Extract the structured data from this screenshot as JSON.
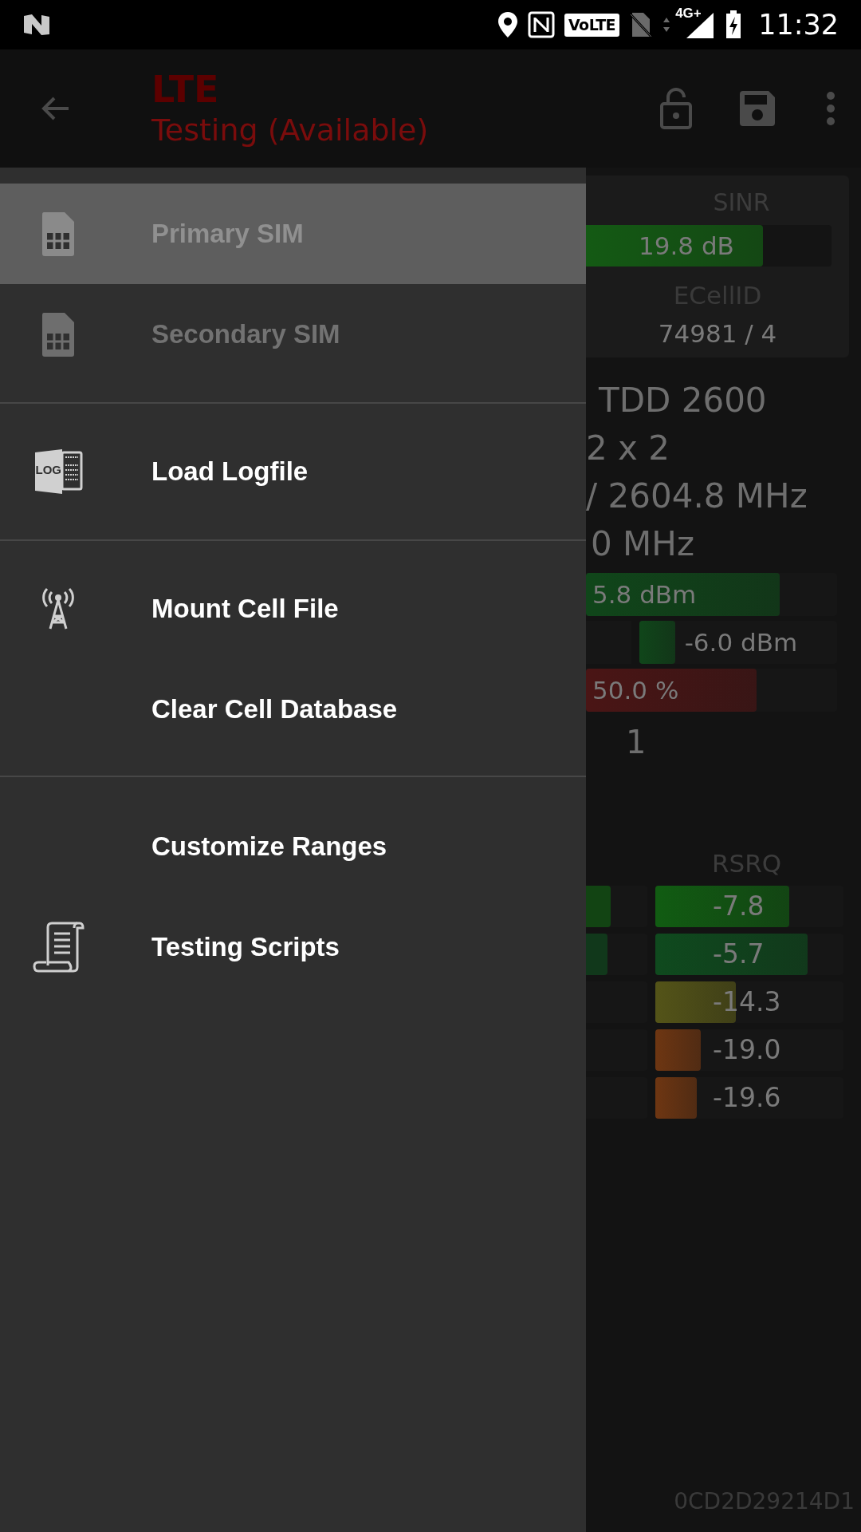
{
  "status_bar": {
    "time": "11:32",
    "volte": "VoLTE",
    "network": "4G+"
  },
  "app_bar": {
    "title": "LTE",
    "subtitle": "Testing (Available)"
  },
  "drawer": {
    "sections": [
      {
        "items": [
          {
            "label": "Primary SIM",
            "selected": true,
            "disabled": true
          },
          {
            "label": "Secondary SIM",
            "selected": false,
            "disabled": true
          }
        ]
      },
      {
        "items": [
          {
            "label": "Load Logfile",
            "selected": false,
            "disabled": false,
            "icon_text": "LOG"
          }
        ]
      },
      {
        "items": [
          {
            "label": "Mount Cell File",
            "selected": false,
            "disabled": false
          },
          {
            "label": "Clear Cell Database",
            "selected": false,
            "disabled": false
          }
        ]
      },
      {
        "items": [
          {
            "label": "Customize Ranges",
            "selected": false,
            "disabled": false
          },
          {
            "label": "Testing Scripts",
            "selected": false,
            "disabled": false
          }
        ]
      }
    ]
  },
  "card": {
    "sinr": {
      "label": "SINR",
      "reading": "19.8 dB",
      "level": 0.72,
      "color": "#145a14"
    },
    "ecellid": {
      "label": "ECellID",
      "value": "74981 / 4"
    }
  },
  "lines": [
    "TDD 2600",
    "2 x 2",
    "/ 2604.8 MHz",
    "0 MHz"
  ],
  "bars": [
    {
      "kind": "full",
      "reading": "5.8 dBm",
      "level": 0.77,
      "color": "#10461a"
    },
    {
      "kind": "split",
      "reading": "-6.0 dBm",
      "level": 0.18,
      "color": "#10461a"
    },
    {
      "kind": "full",
      "reading": "50.0 %",
      "level": 0.68,
      "color": "#4a1515"
    }
  ],
  "count": "1",
  "rsrq": {
    "label": "RSRQ",
    "rows": [
      {
        "reading": "-7.8",
        "level": 0.71,
        "color": "#115c12",
        "left_bar": {
          "level": 0.4
        }
      },
      {
        "reading": "-5.7",
        "level": 0.81,
        "color": "#0f4a1e",
        "left_bar": {
          "level": 0.35
        }
      },
      {
        "reading": "-14.3",
        "level": 0.43,
        "color": "#545418"
      },
      {
        "reading": "-19.0",
        "level": 0.24,
        "color": "#6e3612"
      },
      {
        "reading": "-19.6",
        "level": 0.22,
        "color": "#6e3612"
      }
    ]
  },
  "device_id": "0CD2D29214D1"
}
